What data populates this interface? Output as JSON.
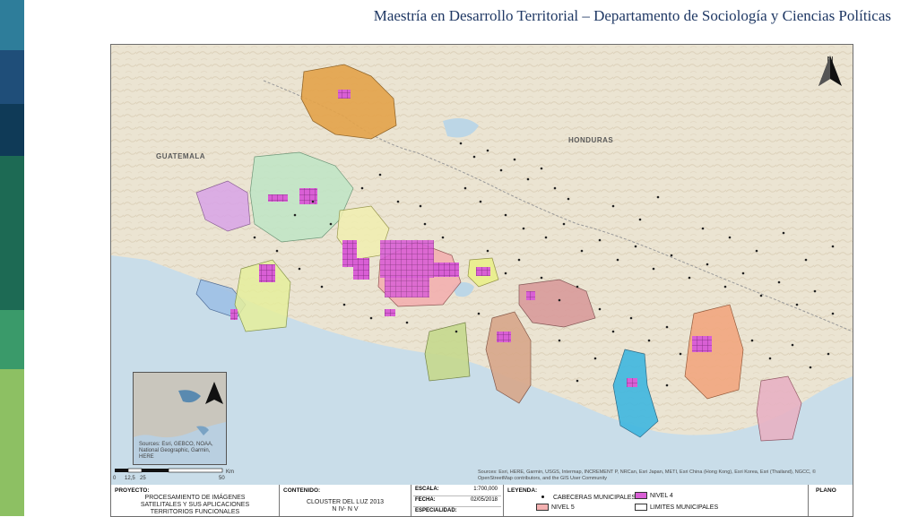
{
  "header": {
    "title": "Maestría en Desarrollo Territorial – Departamento de Sociología y Ciencias Políticas"
  },
  "sidebar_colors": [
    "#2e7d9a",
    "#1f4e79",
    "#0f3a57",
    "#1d6a54",
    "#3a9a6a",
    "#8dc063"
  ],
  "map": {
    "country_labels": {
      "guatemala": "GUATEMALA",
      "honduras": "HONDURAS"
    },
    "north_label": "N",
    "inset_sources": "Sources: Esri, GEBCO, NOAA, National Geographic, Garmin, HERE",
    "scale": {
      "ticks": [
        "0",
        "12,5",
        "25",
        "50"
      ],
      "unit": "Km"
    },
    "sources": "Sources: Esri, HERE, Garmin, USGS, Intermap, INCREMENT P, NRCan, Esri Japan, METI, Esri China (Hong Kong), Esri Korea, Esri (Thailand), NGCC, © OpenStreetMap contributors, and the GIS User Community",
    "colors": {
      "land": "#eae3d2",
      "sea": "#c9dde9",
      "nivel4": "#d95fd5",
      "nivel5": "#f3b0b0"
    }
  },
  "title_block": {
    "proyecto_head": "PROYECTO:",
    "proyecto_value": "PROCESAMIENTO DE IMÁGENES SATELITALES Y SUS APLICACIONES TERRITORIOS FUNCIONALES",
    "contenido_head": "CONTENIDO:",
    "contenido_value_1": "CLOUSTER DEL LUZ 2013",
    "contenido_value_2": "N IV- N V",
    "escala_head": "ESCALA:",
    "escala_value": "1:700,000",
    "fecha_head": "FECHA:",
    "fecha_value": "02/05/2018",
    "especialidad_head": "ESPECIALIDAD:",
    "leyenda_head": "LEYENDA:",
    "legend": {
      "cabeceras": "CABECERAS MUNICIPALES",
      "nivel5": "NIVEL 5",
      "nivel4": "NIVEL 4",
      "limites": "LIMITES MUNICIPALES"
    },
    "plano_head": "PLANO"
  }
}
